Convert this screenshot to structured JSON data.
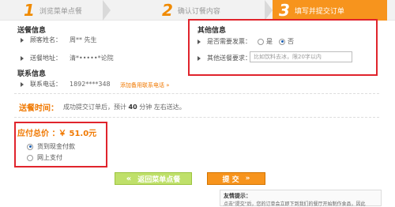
{
  "steps": [
    {
      "num": "1",
      "label": "浏览菜单点餐"
    },
    {
      "num": "2",
      "label": "确认订餐内容"
    },
    {
      "num": "3",
      "label": "填写并提交订单"
    }
  ],
  "delivery": {
    "title": "送餐信息",
    "name_label": "顾客姓名：",
    "name_value": "周** 先生",
    "address_label": "送餐地址：",
    "address_value": "清*•••••*论院"
  },
  "contact": {
    "title": "联系信息",
    "phone_label": "联系电话：",
    "phone_value": "1892****348",
    "add_link": "添加备用联系电话 »"
  },
  "other": {
    "title": "其他信息",
    "invoice_label": "是否需要发票：",
    "invoice_options": [
      "是",
      "否"
    ],
    "invoice_selected": "否",
    "requirement_label": "其他送餐要求：",
    "requirement_placeholder": "比如饮料去冰，限20字以内"
  },
  "delivery_time": {
    "title": "送餐时间：",
    "text_before": "成功提交订单后，预计",
    "minutes": "40",
    "text_after": "分钟 左右送达。"
  },
  "payment": {
    "label": "应付总价 ：",
    "amount": "￥ 51.0元",
    "options": [
      "货到现金付款",
      "网上支付"
    ],
    "selected": "货到现金付款"
  },
  "buttons": {
    "back": "返回菜单点餐",
    "back_arrows": "«",
    "submit": "提  交",
    "submit_arrows": "»"
  },
  "hint": {
    "title": "友情提示：",
    "text": "点击\"提交\"后，您的订单会立即下到我们的餐厅开始制作食品，因此"
  }
}
